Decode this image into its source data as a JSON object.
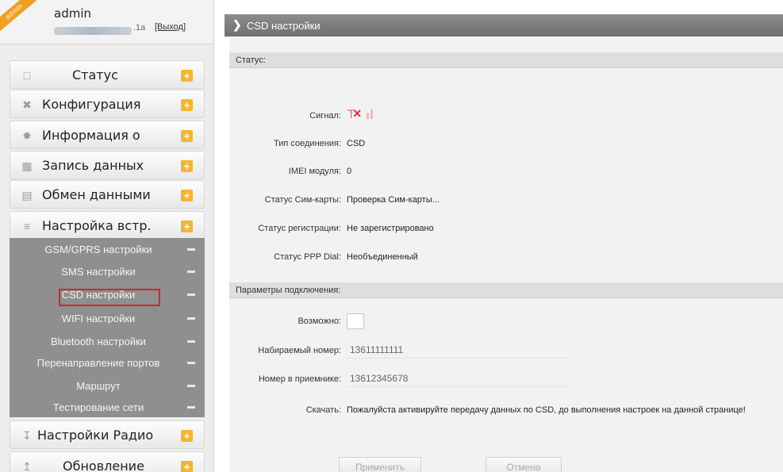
{
  "user": {
    "badge": "admin",
    "name": "admin",
    "ip_suffix": ".1a",
    "logout": "[Выход]"
  },
  "menu": [
    {
      "label": "Статус",
      "icon": "monitor-icon"
    },
    {
      "label": "Конфигурация",
      "icon": "wrench-icon"
    },
    {
      "label": "Информация о",
      "icon": "satellite-icon"
    },
    {
      "label": "Запись данных",
      "icon": "calendar-icon"
    },
    {
      "label": "Обмен данными",
      "icon": "network-icon"
    },
    {
      "label": "Настройка встр.",
      "icon": "antenna-icon"
    }
  ],
  "submenu": [
    {
      "label": "GSM/GPRS настройки"
    },
    {
      "label": "SMS настройки"
    },
    {
      "label": "CSD настройки",
      "active": true
    },
    {
      "label": "WIFI настройки"
    },
    {
      "label": "Bluetooth настройки"
    },
    {
      "label": "Перенаправление портов"
    },
    {
      "label": "Маршрут"
    },
    {
      "label": "Тестирование сети"
    }
  ],
  "menu_bottom": [
    {
      "label": "Настройки Радио",
      "icon": "radio-icon"
    },
    {
      "label": "Обновление",
      "icon": "upload-icon"
    }
  ],
  "page": {
    "title": "CSD настройки"
  },
  "status": {
    "section_title": "Статус:",
    "signal_label": "Сигнал:",
    "conn_type_label": "Тип соединения:",
    "conn_type_value": "CSD",
    "imei_label": "IMEI модуля:",
    "imei_value": "0",
    "sim_label": "Статус Сим-карты:",
    "sim_value": "Проверка Сим-карты...",
    "reg_label": "Статус регистрации:",
    "reg_value": "Не зарегистрировано",
    "ppp_label": "Статус PPP Dial:",
    "ppp_value": "Необъединенный"
  },
  "params": {
    "section_title": "Параметры подключения:",
    "enable_label": "Возможно:",
    "dial_label": "Набираемый номер:",
    "dial_value": "13611111111",
    "receiver_label": "Номер в приемнике:",
    "receiver_value": "13612345678",
    "download_label": "Скачать:",
    "download_value": "Пожалуйста активируйте передачу данных по CSD, до выполнения настроек на данной странице!"
  },
  "buttons": {
    "apply": "Применить",
    "cancel": "Отмена"
  },
  "colors": {
    "accent_plus": "#f2b632",
    "highlight_box": "#d8232a",
    "submenu_bg": "#8f8f8f",
    "titlebar": "#7a7a7a"
  }
}
